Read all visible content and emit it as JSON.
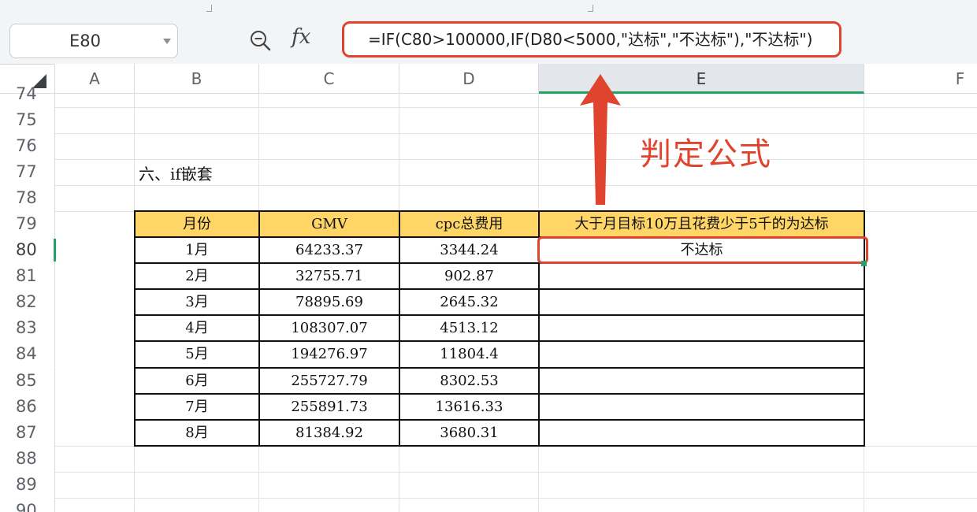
{
  "name_box": {
    "value": "E80"
  },
  "formula_bar": {
    "fx_label": "fx",
    "formula": "=IF(C80>100000,IF(D80<5000,\"达标\",\"不达标\"),\"不达标\")"
  },
  "columns": [
    "A",
    "B",
    "C",
    "D",
    "E",
    "F"
  ],
  "active_column": "E",
  "rows": [
    "74",
    "75",
    "76",
    "77",
    "78",
    "79",
    "80",
    "81",
    "82",
    "83",
    "84",
    "85",
    "86",
    "87",
    "88",
    "89",
    "90"
  ],
  "active_row": "80",
  "section_title": "六、if嵌套",
  "table": {
    "headers": [
      "月份",
      "GMV",
      "cpc总费用",
      "大于月目标10万且花费少于5千的为达标"
    ],
    "rows": [
      [
        "1月",
        "64233.37",
        "3344.24",
        "不达标"
      ],
      [
        "2月",
        "32755.71",
        "902.87",
        ""
      ],
      [
        "3月",
        "78895.69",
        "2645.32",
        ""
      ],
      [
        "4月",
        "108307.07",
        "4513.12",
        ""
      ],
      [
        "5月",
        "194276.97",
        "11804.4",
        ""
      ],
      [
        "6月",
        "255727.79",
        "8302.53",
        ""
      ],
      [
        "7月",
        "255891.73",
        "13616.33",
        ""
      ],
      [
        "8月",
        "81384.92",
        "3680.31",
        ""
      ]
    ]
  },
  "annotation": {
    "text": "判定公式",
    "color": "#e0432e"
  },
  "colors": {
    "header_fill": "#ffd666",
    "accent_green": "#21a366",
    "highlight_red": "#e0432e"
  }
}
